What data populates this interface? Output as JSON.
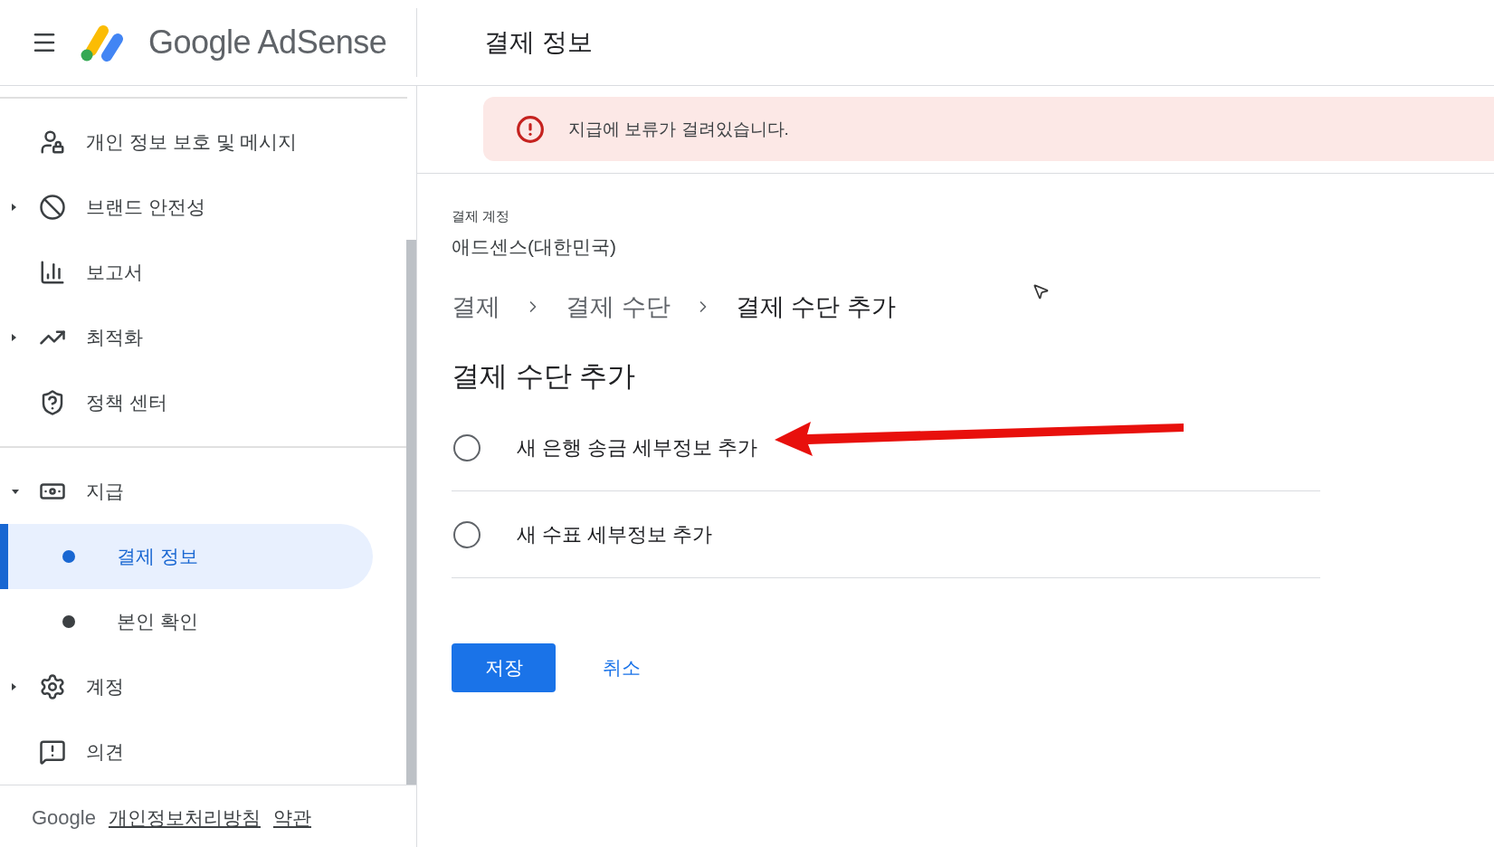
{
  "header": {
    "product": "Google AdSense",
    "page_title": "결제 정보"
  },
  "sidebar": {
    "sections": [
      {
        "items": [
          {
            "label": "개인 정보 보호 및 메시지",
            "selected": false
          },
          {
            "label": "브랜드 안전성",
            "selected": false,
            "expanded": false
          },
          {
            "label": "보고서",
            "selected": false
          },
          {
            "label": "최적화",
            "selected": false,
            "expanded": false
          },
          {
            "label": "정책 센터",
            "selected": false
          }
        ]
      },
      {
        "items": [
          {
            "label": "지급",
            "selected": false,
            "expanded": true,
            "children": [
              {
                "label": "결제 정보",
                "selected": true
              },
              {
                "label": "본인 확인",
                "selected": false
              }
            ]
          },
          {
            "label": "계정",
            "selected": false,
            "expanded": false
          },
          {
            "label": "의견",
            "selected": false
          }
        ]
      }
    ]
  },
  "footer": {
    "brand": "Google",
    "links": [
      "개인정보처리방침",
      "약관"
    ]
  },
  "alert": {
    "message": "지급에 보류가 걸려있습니다."
  },
  "account": {
    "label": "결제 계정",
    "value": "애드센스(대한민국)"
  },
  "breadcrumb": [
    "결제",
    "결제 수단",
    "결제 수단 추가"
  ],
  "heading": "결제 수단 추가",
  "options": [
    {
      "label": "새 은행 송금 세부정보 추가",
      "selected": false
    },
    {
      "label": "새 수표 세부정보 추가",
      "selected": false
    }
  ],
  "buttons": {
    "save": "저장",
    "cancel": "취소"
  }
}
